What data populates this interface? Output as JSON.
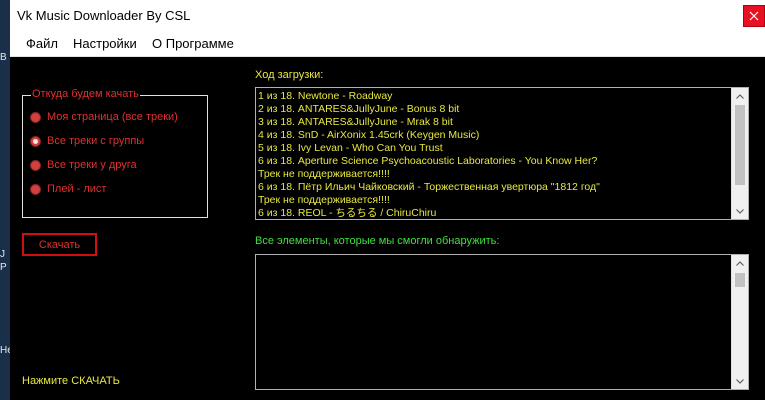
{
  "window": {
    "title": "Vk Music Downloader By CSL"
  },
  "menu": {
    "items": [
      "Файл",
      "Настройки",
      "О Программе"
    ]
  },
  "source_group": {
    "legend": "Откуда будем качать",
    "options": [
      {
        "label": "Моя страница (все треки)",
        "selected": false
      },
      {
        "label": "Все треки с группы",
        "selected": true
      },
      {
        "label": "Все треки у друга",
        "selected": false
      },
      {
        "label": "Плей - лист",
        "selected": false
      }
    ]
  },
  "download_button": {
    "label": "Скачать"
  },
  "status": {
    "text": "Нажмите СКАЧАТЬ"
  },
  "progress": {
    "label": "Ход загрузки:",
    "lines": [
      "1 из 18. Newtone - Roadway",
      "2 из 18. ANTARES&JullyJune - Bonus 8 bit",
      "3 из 18. ANTARES&JullyJune - Mrak 8 bit",
      "4 из 18. SnD - AirXonix 1.45crk (Keygen Music)",
      "5 из 18. Ivy Levan - Who Can You Trust",
      "6 из 18. Aperture Science Psychoacoustic Laboratories - You Know Her?",
      "Трек не поддерживается!!!!",
      "6 из 18. Пётр Ильич Чайковский - Торжественная увертюра \"1812 год\"",
      "Трек не поддерживается!!!!",
      "6 из 18. REOL - ちるちる / ChiruChiru"
    ]
  },
  "found": {
    "label": "Все элементы, которые мы смогли обнаружить:"
  },
  "desktop": {
    "glyphs": [
      "В",
      "J",
      "Р",
      "Не"
    ]
  },
  "colors": {
    "accent_red": "#e03030",
    "text_yellow": "#e8e840",
    "text_green": "#40e040",
    "close_red": "#e81123"
  }
}
